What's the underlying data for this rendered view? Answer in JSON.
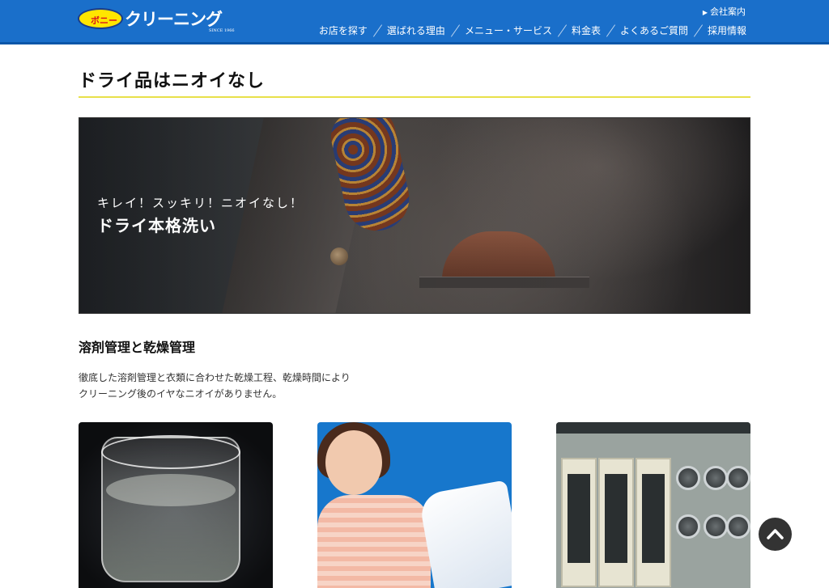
{
  "header": {
    "logo_badge": "ボニー",
    "logo_word": "クリーニング",
    "logo_since": "SINCE 1966",
    "company_link": "会社案内",
    "nav": [
      {
        "label": "お店を探す"
      },
      {
        "label": "選ばれる理由"
      },
      {
        "label": "メニュー・サービス"
      },
      {
        "label": "料金表"
      },
      {
        "label": "よくあるご質問"
      },
      {
        "label": "採用情報"
      }
    ]
  },
  "page": {
    "title": "ドライ品はニオイなし"
  },
  "hero": {
    "subtitle": "キレイ！スッキリ！ニオイなし！",
    "title": "ドライ本格洗い"
  },
  "section": {
    "heading": "溶剤管理と乾燥管理",
    "body_line1": "徹底した溶剤管理と衣類に合わせた乾燥工程、乾燥時間により",
    "body_line2": "クリーニング後のイヤなニオイがありません。"
  },
  "colors": {
    "header_bg": "#1a6fca",
    "title_rule": "#e8e04a",
    "logo_yellow": "#ffe600"
  },
  "icons": {
    "to_top": "chevron-up-icon",
    "company_link": "triangle-right-icon"
  }
}
